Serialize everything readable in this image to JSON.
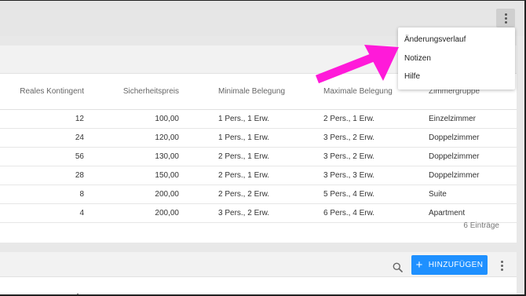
{
  "table": {
    "headers": [
      "Reales Kontingent",
      "Sicherheitspreis",
      "Minimale Belegung",
      "Maximale Belegung",
      "Zimmergruppe"
    ],
    "rows": [
      [
        "12",
        "100,00",
        "1 Pers., 1 Erw.",
        "2 Pers., 1 Erw.",
        "Einzelzimmer"
      ],
      [
        "24",
        "120,00",
        "1 Pers., 1 Erw.",
        "3 Pers., 2 Erw.",
        "Doppelzimmer"
      ],
      [
        "56",
        "130,00",
        "2 Pers., 1 Erw.",
        "3 Pers., 2 Erw.",
        "Doppelzimmer"
      ],
      [
        "28",
        "150,00",
        "2 Pers., 1 Erw.",
        "3 Pers., 3 Erw.",
        "Doppelzimmer"
      ],
      [
        "8",
        "200,00",
        "2 Pers., 2 Erw.",
        "5 Pers., 4 Erw.",
        "Suite"
      ],
      [
        "4",
        "200,00",
        "3 Pers., 2 Erw.",
        "6 Pers., 4 Erw.",
        "Apartment"
      ]
    ],
    "count_label": "6 Einträge"
  },
  "menu": {
    "items": [
      "Änderungsverlauf",
      "Notizen",
      "Hilfe"
    ]
  },
  "toolbar": {
    "add_label": "HINZUFÜGEN",
    "add_icon": "plus-icon",
    "search_icon": "search-icon",
    "more_icon": "more-vertical-icon"
  },
  "colors": {
    "accent": "#1e90ff",
    "annotation_arrow": "#ff1ad9",
    "page_background": "#e8e8e8"
  },
  "stray_text": "Anz"
}
